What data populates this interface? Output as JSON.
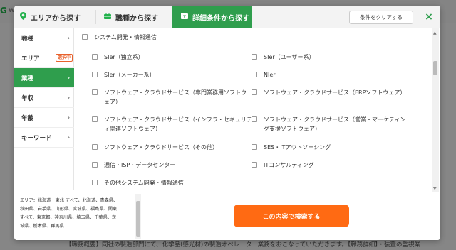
{
  "background": {
    "logo_mark": "G",
    "logo_text": "w",
    "bottom_text": "【職務概要】同社の製造部門にて、化学品(感光材)の製造オペレーター業務をおこなっていただきます。【職務詳細】・装置の監視業"
  },
  "tabs": {
    "area": {
      "label": "エリアから探す",
      "icon": "map-pin-icon"
    },
    "job": {
      "label": "職種から探す",
      "icon": "briefcase-icon"
    },
    "detail": {
      "label": "詳細条件から探す",
      "icon": "filter-folder-icon"
    }
  },
  "header": {
    "clear_label": "条件をクリアする",
    "close_glyph": "×"
  },
  "sidebar": {
    "items": [
      {
        "label": "職種"
      },
      {
        "label": "エリア",
        "badge": "選択中"
      },
      {
        "label": "業種"
      },
      {
        "label": "年収"
      },
      {
        "label": "年齢"
      },
      {
        "label": "キーワード"
      }
    ]
  },
  "category": {
    "label": "システム開発・情報通信"
  },
  "options": [
    {
      "line1": "SIer（独立系）",
      "line2": ""
    },
    {
      "line1": "SIer（ユーザー系）",
      "line2": ""
    },
    {
      "line1": "SIer（メーカー系）",
      "line2": ""
    },
    {
      "line1": "NIer",
      "line2": ""
    },
    {
      "line1": "ソフトウェア・クラウドサービス（専門業務用ソフトウ",
      "line2": "ェア）"
    },
    {
      "line1": "ソフトウェア・クラウドサービス（ERPソフトウェア）",
      "line2": ""
    },
    {
      "line1": "ソフトウェア・クラウドサービス（インフラ・セキュリテ",
      "line2": "ィ関連ソフトウェア）"
    },
    {
      "line1": "ソフトウェア・クラウドサービス（営業・マーケティン",
      "line2": "グ支援ソフトウェア）"
    },
    {
      "line1": "ソフトウェア・クラウドサービス（その他）",
      "line2": ""
    },
    {
      "line1": "SES・ITアウトソーシング",
      "line2": ""
    },
    {
      "line1": "通信・ISP・データセンター",
      "line2": ""
    },
    {
      "line1": "ITコンサルティング",
      "line2": ""
    },
    {
      "line1": "その他システム開発・情報通信",
      "line2": ""
    }
  ],
  "footer": {
    "summary_lines": [
      "エリア：北海道・東北 すべて、北海道、青森県、",
      "秋田県、岩手県、山形県、宮城県、福島県、関東",
      "すべて、東京都、神奈川県、埼玉県、千葉県、茨",
      "城県、栃木県、群馬県"
    ],
    "search_label": "この内容で検索する"
  },
  "colors": {
    "accent_green": "#2f9e4d",
    "search_orange": "#ff6a13",
    "badge_orange": "#e8612c"
  }
}
